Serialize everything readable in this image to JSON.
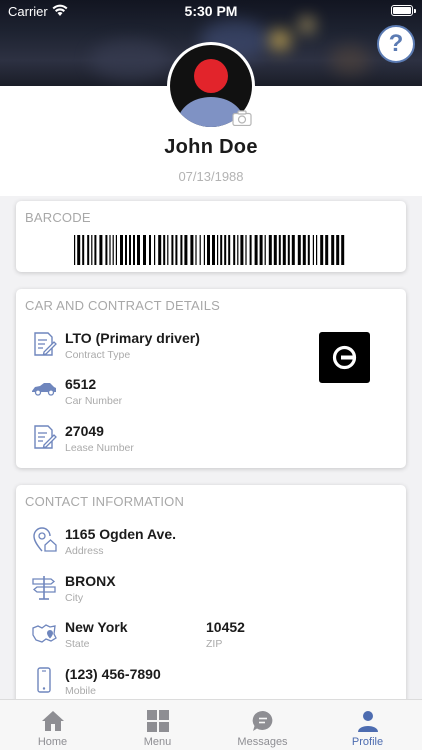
{
  "status_bar": {
    "carrier": "Carrier",
    "time": "5:30 PM"
  },
  "help": {
    "label": "?"
  },
  "profile": {
    "name": "John Doe",
    "dob": "07/13/1988"
  },
  "barcode_card": {
    "title": "BARCODE"
  },
  "car_card": {
    "title": "CAR AND CONTRACT DETAILS",
    "rows": [
      {
        "value": "LTO (Primary driver)",
        "label": "Contract Type",
        "icon": "document-edit-icon"
      },
      {
        "value": "6512",
        "label": "Car Number",
        "icon": "car-icon"
      },
      {
        "value": "27049",
        "label": "Lease Number",
        "icon": "document-edit-icon"
      }
    ],
    "logo": "uber-logo"
  },
  "contact_card": {
    "title": "CONTACT INFORMATION",
    "address": {
      "value": "1165 Ogden Ave.",
      "label": "Address",
      "icon": "location-home-icon"
    },
    "city": {
      "value": "BRONX",
      "label": "City",
      "icon": "signpost-icon"
    },
    "state": {
      "value": "New York",
      "label": "State",
      "icon": "map-icon"
    },
    "zip": {
      "value": "10452",
      "label": "ZIP"
    },
    "mobile": {
      "value": "(123) 456-7890",
      "label": "Mobile",
      "icon": "phone-icon"
    }
  },
  "tabbar": {
    "tabs": [
      {
        "label": "Home",
        "icon": "home-icon"
      },
      {
        "label": "Menu",
        "icon": "grid-icon"
      },
      {
        "label": "Messages",
        "icon": "chat-icon"
      },
      {
        "label": "Profile",
        "icon": "person-icon",
        "active": true
      }
    ]
  },
  "colors": {
    "accent": "#4d6cb0",
    "icon_blue": "#6f86bd",
    "avatar_head": "#e2242b",
    "avatar_body": "#7f92c4"
  }
}
